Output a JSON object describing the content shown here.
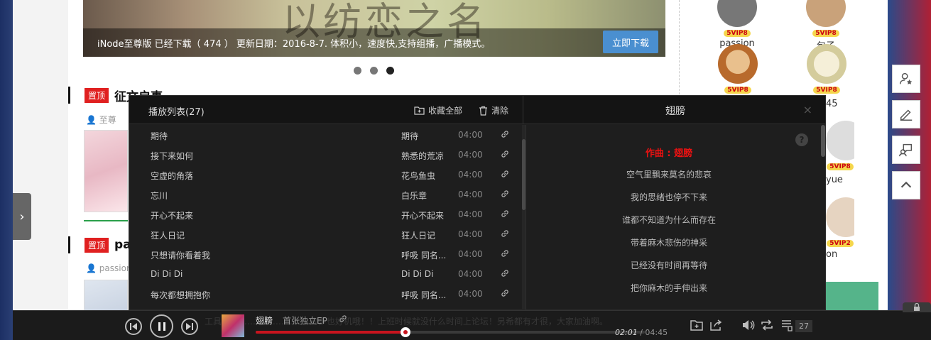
{
  "banner": {
    "art_text": "以纺恋之名",
    "caption": "iNode至尊版 已经下载（ 474 ） 更新日期：2016-8-7. 体积小，速度快,支持组播，广播模式。",
    "download_label": "立即下载"
  },
  "posts": [
    {
      "pin": "置顶",
      "title": "征文启事",
      "author": "至尊"
    },
    {
      "pin": "置顶",
      "title": "pa",
      "author": "passion"
    }
  ],
  "users": [
    {
      "vip": "5VIP8",
      "name": "passion"
    },
    {
      "vip": "5VIP8",
      "name": "包子"
    },
    {
      "vip": "5VIP8",
      "name": ""
    },
    {
      "vip": "5VIP8",
      "name": "45"
    },
    {
      "vip": "5VIP8",
      "name": "yue"
    },
    {
      "vip": "5VIP2",
      "name": "on"
    }
  ],
  "playlist": {
    "title": "播放列表(27)",
    "collect_all": "收藏全部",
    "clear": "清除",
    "rows": [
      {
        "name": "期待",
        "artist": "期待",
        "duration": "04:00"
      },
      {
        "name": "接下来如何",
        "artist": "熟悉的荒凉",
        "duration": "04:00"
      },
      {
        "name": "空虚的角落",
        "artist": "花鸟鱼虫",
        "duration": "04:00"
      },
      {
        "name": "忘川",
        "artist": "白乐章",
        "duration": "04:00"
      },
      {
        "name": "开心不起来",
        "artist": "开心不起来",
        "duration": "04:00"
      },
      {
        "name": "狂人日记",
        "artist": "狂人日记",
        "duration": "04:00"
      },
      {
        "name": "只想请你看着我",
        "artist": "呼吸 同名...",
        "duration": "04:00"
      },
      {
        "name": "Di Di Di",
        "artist": "Di Di Di",
        "duration": "04:00"
      },
      {
        "name": "每次都想拥抱你",
        "artist": "呼吸 同名...",
        "duration": "04:00"
      }
    ]
  },
  "lyrics_panel": {
    "song_title": "翅膀",
    "help": "?",
    "close": "×",
    "lines": [
      {
        "text": "作曲 : 翅膀",
        "highlight": true
      },
      {
        "text": "空气里飘来莫名的悲哀",
        "highlight": false
      },
      {
        "text": "我的思绪也停不下来",
        "highlight": false
      },
      {
        "text": "谁都不知道为什么而存在",
        "highlight": false
      },
      {
        "text": "带着麻木悲伤的神采",
        "highlight": false
      },
      {
        "text": "已经没有时间再等待",
        "highlight": false
      },
      {
        "text": "把你麻木的手伸出来",
        "highlight": false
      }
    ]
  },
  "player": {
    "song": "翅膀",
    "album": "首张独立EP",
    "current_time": "02:01",
    "total_time": "04:45",
    "progress": 0.385,
    "playlist_count": "27",
    "ghost_text": "工具 …………………………的多也好机哦！！上班时候就没什么时间上论坛！另希都有才很，大家加油啊。"
  },
  "icons": [
    "prev-icon",
    "pause-icon",
    "next-icon",
    "link-icon",
    "add-folder-icon",
    "share-icon",
    "volume-icon",
    "repeat-icon",
    "playlist-icon",
    "trash-icon",
    "user-star-icon",
    "edit-icon",
    "feedback-icon",
    "arrow-up-icon",
    "chevron-right-icon",
    "lock-icon"
  ],
  "colors": {
    "accent": "#c8141e",
    "panel": "#1e1e1e",
    "download": "#4a8fd0"
  }
}
